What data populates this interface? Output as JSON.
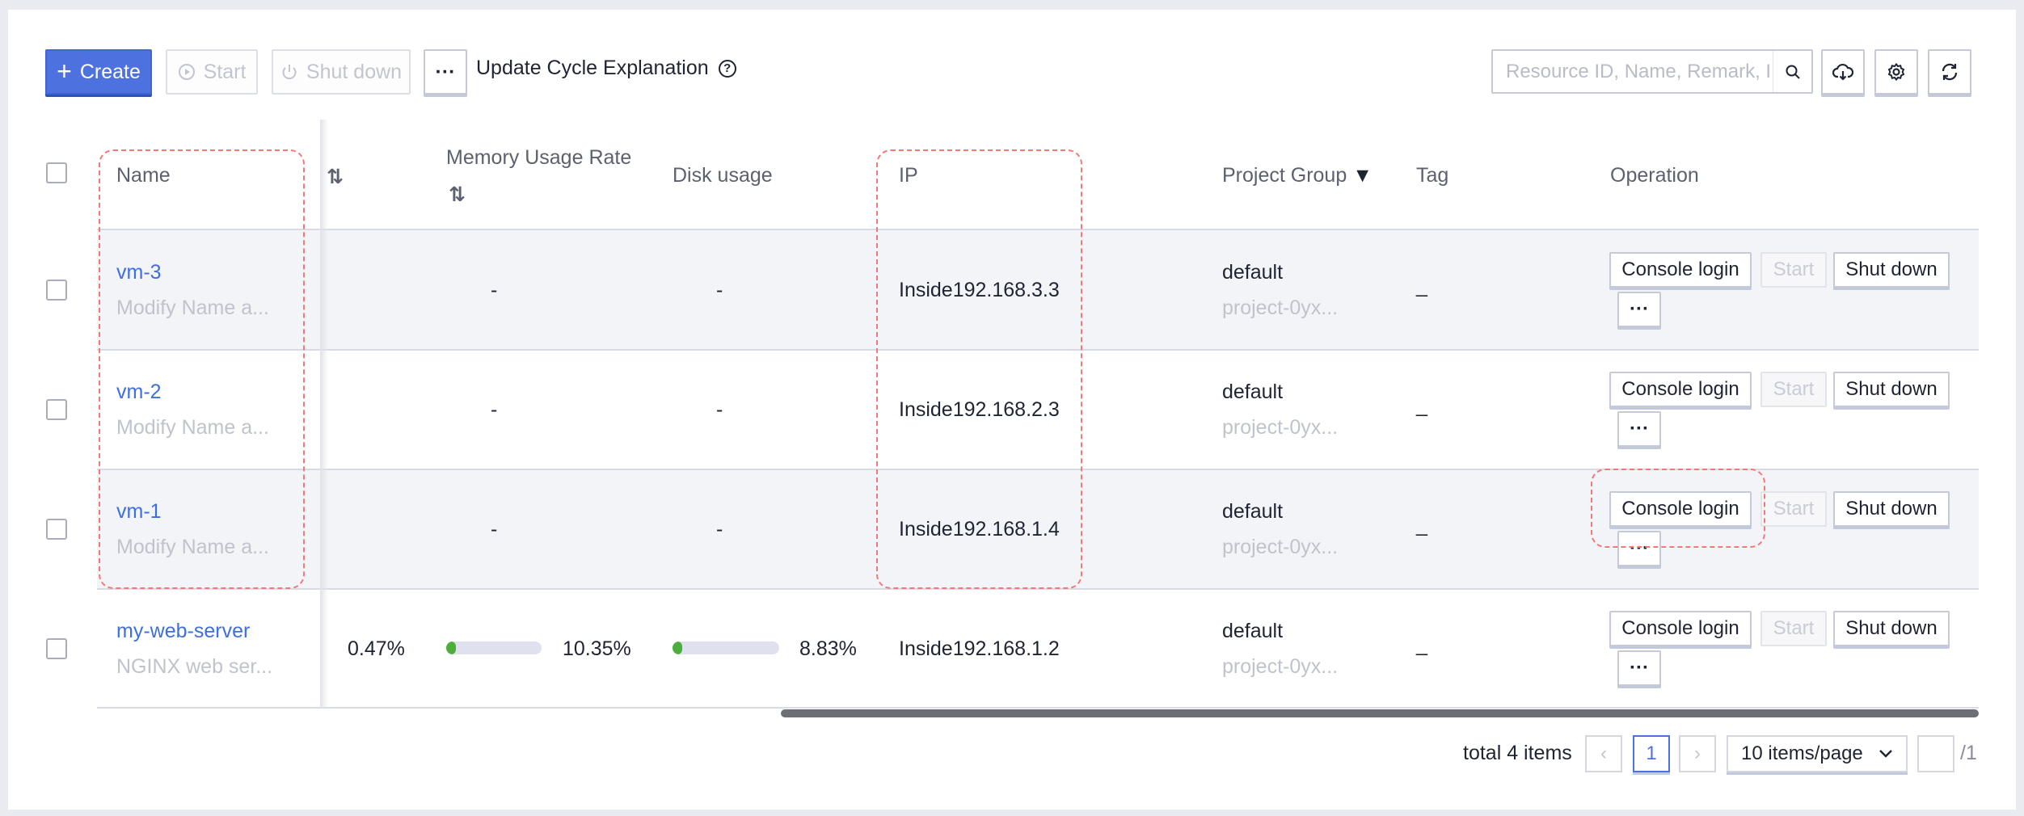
{
  "toolbar": {
    "create_label": "Create",
    "start_label": "Start",
    "shutdown_label": "Shut down",
    "more_label": "···",
    "update_cycle_label": "Update Cycle Explanation",
    "search_placeholder": "Resource ID, Name, Remark, IP",
    "icons": [
      "cloud-download-icon",
      "gear-icon",
      "refresh-icon"
    ]
  },
  "columns": {
    "name": "Name",
    "memory": "Memory Usage Rate",
    "disk": "Disk usage",
    "ip": "IP",
    "project_group": "Project Group",
    "tag": "Tag",
    "operation": "Operation"
  },
  "rows": [
    {
      "name": "vm-3",
      "remark": "Modify Name a...",
      "cpu": "",
      "memory": "-",
      "disk": "-",
      "ip": "Inside192.168.3.3",
      "project": "default",
      "project_id": "project-0yx...",
      "tag": "_"
    },
    {
      "name": "vm-2",
      "remark": "Modify Name a...",
      "cpu": "",
      "memory": "-",
      "disk": "-",
      "ip": "Inside192.168.2.3",
      "project": "default",
      "project_id": "project-0yx...",
      "tag": "_"
    },
    {
      "name": "vm-1",
      "remark": "Modify Name a...",
      "cpu": "",
      "memory": "-",
      "disk": "-",
      "ip": "Inside192.168.1.4",
      "project": "default",
      "project_id": "project-0yx...",
      "tag": "_"
    },
    {
      "name": "my-web-server",
      "remark": "NGINX web ser...",
      "cpu": "0.47%",
      "memory": "10.35%",
      "disk": "8.83%",
      "ip": "Inside192.168.1.2",
      "project": "default",
      "project_id": "project-0yx...",
      "tag": "_",
      "memory_fraction": 0.1035,
      "disk_fraction": 0.0883
    }
  ],
  "operations": {
    "console_login": "Console login",
    "start": "Start",
    "shutdown": "Shut down",
    "more": "···"
  },
  "pagination": {
    "total_text": "total 4 items",
    "prev": "‹",
    "current_page": "1",
    "next": "›",
    "page_size": "10 items/page",
    "jump_value": "",
    "total_pages": "/1"
  },
  "colors": {
    "accent": "#4d72e0",
    "link": "#3d6fe0",
    "bar_fill": "#4cae3b",
    "annotation": "#f07a7a"
  }
}
